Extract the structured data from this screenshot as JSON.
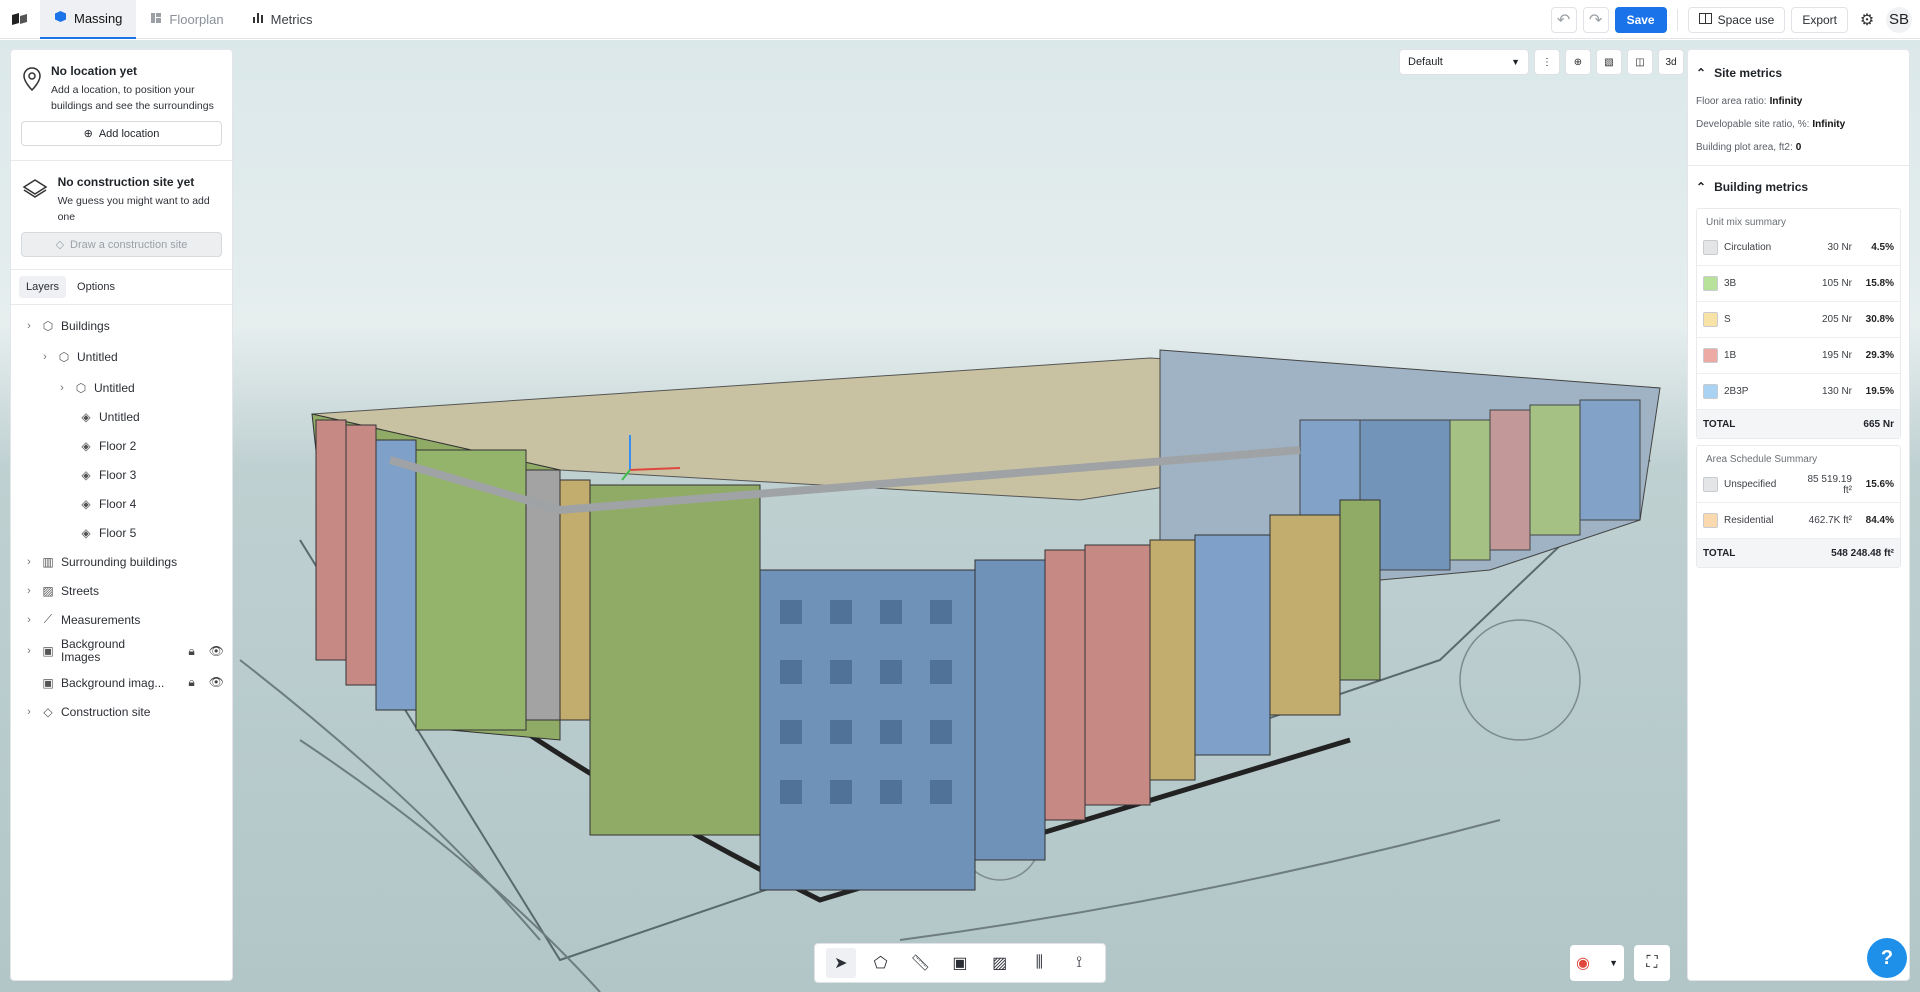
{
  "topbar": {
    "tabs": [
      {
        "label": "Massing",
        "icon": "cube-icon"
      },
      {
        "label": "Floorplan",
        "icon": "floorplan-icon"
      },
      {
        "label": "Metrics",
        "icon": "bar-chart-icon"
      }
    ],
    "save_label": "Save",
    "space_use_label": "Space use",
    "export_label": "Export",
    "avatar_initials": "SB"
  },
  "location_card": {
    "title": "No location yet",
    "description": "Add a location, to position your buildings and see the surroundings",
    "button_label": "Add location"
  },
  "site_card": {
    "title": "No construction site yet",
    "description": "We guess you might want to add one",
    "button_label": "Draw a construction site"
  },
  "left_tabs": [
    "Layers",
    "Options"
  ],
  "layers": {
    "buildings": "Buildings",
    "untitled_1": "Untitled",
    "untitled_2": "Untitled",
    "untitled_3": "Untitled",
    "floor_2": "Floor 2",
    "floor_3": "Floor 3",
    "floor_4": "Floor 4",
    "floor_5": "Floor 5",
    "surrounding": "Surrounding buildings",
    "streets": "Streets",
    "measurements": "Measurements",
    "background_images": "Background Images",
    "background_image_item": "Background imag...",
    "construction_site": "Construction site"
  },
  "viewbar": {
    "preset": "Default",
    "mode_3d": "3d"
  },
  "site_metrics": {
    "title": "Site metrics",
    "far_label": "Floor area ratio:",
    "far_value": "Infinity",
    "dsr_label": "Developable site ratio, %:",
    "dsr_value": "Infinity",
    "bpa_label": "Building plot area, ft2:",
    "bpa_value": "0"
  },
  "building_metrics": {
    "title": "Building metrics",
    "unit_mix_title": "Unit mix summary",
    "unit_mix": [
      {
        "name": "Circulation",
        "value": "30 Nr",
        "pct": "4.5%",
        "color": "#e4e5e7"
      },
      {
        "name": "3B",
        "value": "105 Nr",
        "pct": "15.8%",
        "color": "#b8e19a"
      },
      {
        "name": "S",
        "value": "205 Nr",
        "pct": "30.8%",
        "color": "#f7e3a6"
      },
      {
        "name": "1B",
        "value": "195 Nr",
        "pct": "29.3%",
        "color": "#eda9a3"
      },
      {
        "name": "2B3P",
        "value": "130 Nr",
        "pct": "19.5%",
        "color": "#a9d2f3"
      }
    ],
    "unit_total_label": "TOTAL",
    "unit_total_value": "665 Nr",
    "area_title": "Area Schedule Summary",
    "area": [
      {
        "name": "Unspecified",
        "value": "85 519.19 ft²",
        "pct": "15.6%",
        "color": "#e4e5e7"
      },
      {
        "name": "Residential",
        "value": "462.7K ft²",
        "pct": "84.4%",
        "color": "#f9d9ad"
      }
    ],
    "area_total_label": "TOTAL",
    "area_total_value": "548 248.48 ft²"
  },
  "help_label": "?"
}
